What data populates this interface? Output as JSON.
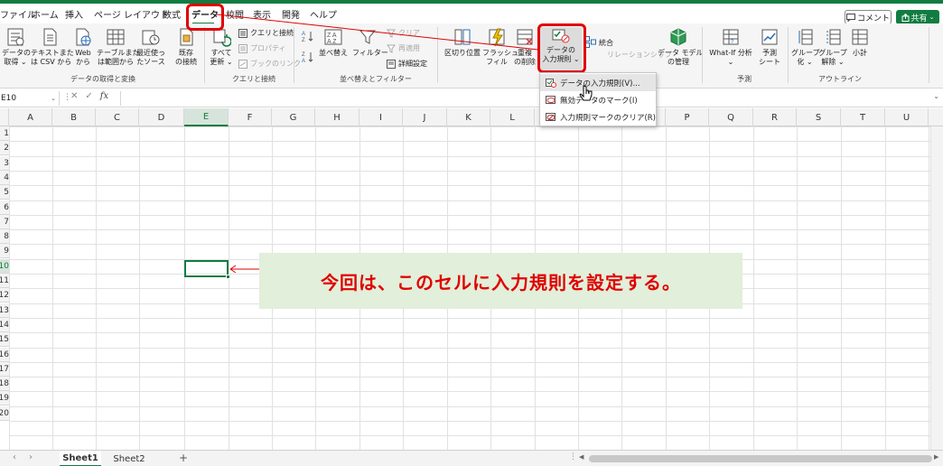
{
  "menu_tabs": [
    "ファイル",
    "ホーム",
    "挿入",
    "ページ レイアウト",
    "数式",
    "データ",
    "校閲",
    "表示",
    "開発",
    "ヘルプ"
  ],
  "header": {
    "comment_label": "コメント",
    "share_label": "共有"
  },
  "ribbon": {
    "get_data": {
      "label1": "データの",
      "label2": "取得 ⌄"
    },
    "from_text": {
      "label1": "テキストまた",
      "label2": "は CSV から"
    },
    "from_web": {
      "label1": "Web",
      "label2": "から"
    },
    "from_table": {
      "label1": "テーブルまた",
      "label2": "は範囲から"
    },
    "recent_sources": {
      "label1": "最近使っ",
      "label2": "たソース"
    },
    "existing_conn": {
      "label1": "既存",
      "label2": "の接続"
    },
    "group_get_label": "データの取得と変換",
    "refresh_all": {
      "label1": "すべて",
      "label2": "更新 ⌄"
    },
    "queries_conn": "クエリと接続",
    "properties": "プロパティ",
    "edit_links": "ブックのリンク",
    "group_queries_label": "クエリと接続",
    "sort_label": "並べ替え",
    "filter_label": "フィルター",
    "clear_label": "クリア",
    "reapply_label": "再適用",
    "advanced_label": "詳細設定",
    "group_sort_label": "並べ替えとフィルター",
    "text_to_col": "区切り位置",
    "flash_fill": {
      "label1": "フラッシュ",
      "label2": "フィル"
    },
    "remove_dup": {
      "label1": "重複",
      "label2": "の削除"
    },
    "data_validation": {
      "label1": "データの",
      "label2": "入力規則 ⌄"
    },
    "consolidate": "統合",
    "relationships": "リレーションシップ",
    "data_model": {
      "label1": "データ モデル",
      "label2": "の管理"
    },
    "whatif": {
      "label1": "What-If 分析",
      "label2": "⌄"
    },
    "forecast_sheet": {
      "label1": "予測",
      "label2": "シート"
    },
    "group_forecast_label": "予測",
    "group_btn": {
      "label1": "グループ",
      "label2": "化 ⌄"
    },
    "ungroup_btn": {
      "label1": "グループ",
      "label2": "解除 ⌄"
    },
    "subtotal": "小計",
    "group_outline_label": "アウトライン"
  },
  "formula_bar": {
    "name_box": "E10",
    "fx": "fx",
    "value": ""
  },
  "columns": [
    "A",
    "B",
    "C",
    "D",
    "E",
    "F",
    "G",
    "H",
    "I",
    "J",
    "K",
    "L",
    "M",
    "N",
    "O",
    "P",
    "Q",
    "R",
    "S",
    "T",
    "U"
  ],
  "rows": [
    "1",
    "2",
    "3",
    "4",
    "5",
    "6",
    "7",
    "8",
    "9",
    "10",
    "11",
    "12",
    "13",
    "14",
    "15",
    "16",
    "17",
    "18",
    "19",
    "20"
  ],
  "dropdown": {
    "item1": "データの入力規則(V)...",
    "item2": "無効データのマーク(I)",
    "item3": "入力規則マークのクリア(R)"
  },
  "annotation": "今回は、このセルに入力規則を設定する。",
  "sheets": [
    "Sheet1",
    "Sheet2"
  ],
  "add_sheet": "+",
  "colors": {
    "accent": "#107c41",
    "highlight": "#e00000",
    "note_bg": "#e2efda"
  }
}
